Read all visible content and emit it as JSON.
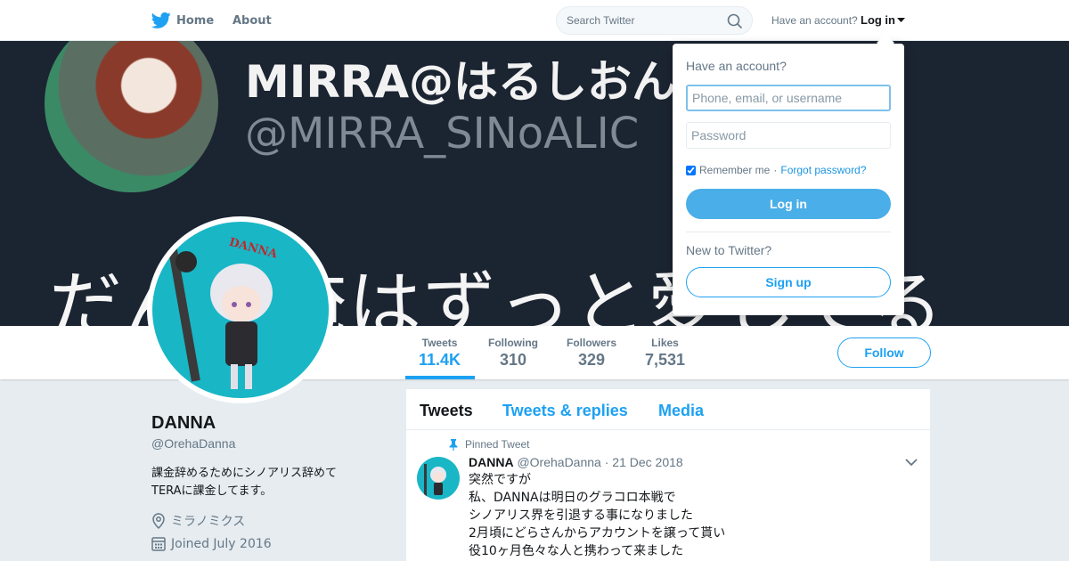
{
  "nav": {
    "home_label": "Home",
    "about_label": "About",
    "search_placeholder": "Search Twitter",
    "have_account": "Have an account?",
    "login_label": "Log in"
  },
  "banner": {
    "title_text": "MIRRA@はるしおん",
    "handle_text": "@MIRRA_SINoALIC",
    "jp_text": "だんな俺はずっと愛してる"
  },
  "profile_nav": {
    "stats": [
      {
        "label": "Tweets",
        "value": "11.4K"
      },
      {
        "label": "Following",
        "value": "310"
      },
      {
        "label": "Followers",
        "value": "329"
      },
      {
        "label": "Likes",
        "value": "7,531"
      }
    ],
    "follow_label": "Follow"
  },
  "profile": {
    "name": "DANNA",
    "handle": "@OrehaDanna",
    "bio_line1": "課金辞めるためにシノアリス辞めて",
    "bio_line2": "TERAに課金してます。",
    "location": "ミラノミクス",
    "joined": "Joined July 2016",
    "avatar_text": "DANNA"
  },
  "timeline": {
    "tabs": [
      "Tweets",
      "Tweets & replies",
      "Media"
    ],
    "pinned_label": "Pinned Tweet",
    "tweet": {
      "name": "DANNA",
      "handle": "@OrehaDanna",
      "date": "· 21 Dec 2018",
      "lines": [
        "突然ですが",
        "私、DANNAは明日のグラコロ本戦で",
        "シノアリス界を引退する事になりました",
        "2月頃にどらさんからアカウントを譲って貰い",
        "役10ヶ月色々な人と携わって来ました"
      ]
    }
  },
  "login_dropdown": {
    "title": "Have an account?",
    "username_placeholder": "Phone, email, or username",
    "password_placeholder": "Password",
    "remember_label": "Remember me",
    "separator": "·",
    "forgot_label": "Forgot password?",
    "login_button": "Log in",
    "new_label": "New to Twitter?",
    "signup_button": "Sign up"
  },
  "colors": {
    "accent": "#1da1f2",
    "banner_bg": "#1b2431",
    "avatar_bg": "#19b6c6",
    "page_bg": "#e6ecf0"
  }
}
